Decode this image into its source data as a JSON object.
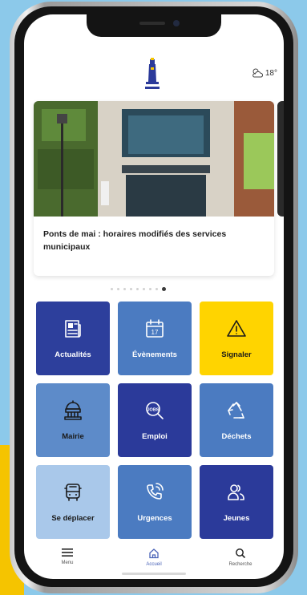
{
  "weather": {
    "temperature": "18°",
    "icon": "partly-cloudy-icon"
  },
  "logo": {
    "icon": "lighthouse-logo-icon"
  },
  "carousel": {
    "cards": [
      {
        "title": "Ponts de mai : horaires modifiés des services municipaux",
        "image": "town-hall-photo"
      }
    ],
    "dot_count": 9,
    "active_index": 8
  },
  "tiles": [
    {
      "label": "Actualités",
      "icon": "newspaper-icon",
      "bg": "#2d3f9c",
      "fg": "#ffffff"
    },
    {
      "label": "Évènements",
      "icon": "calendar-icon",
      "bg": "#4b7bc1",
      "fg": "#ffffff"
    },
    {
      "label": "Signaler",
      "icon": "warning-icon",
      "bg": "#ffd400",
      "fg": "#1a1a1a"
    },
    {
      "label": "Mairie",
      "icon": "town-hall-icon",
      "bg": "#5d8bc9",
      "fg": "#1a1a1a"
    },
    {
      "label": "Emploi",
      "icon": "job-search-icon",
      "bg": "#2b3a9a",
      "fg": "#ffffff"
    },
    {
      "label": "Déchets",
      "icon": "recycle-icon",
      "bg": "#4b7bc1",
      "fg": "#ffffff"
    },
    {
      "label": "Se déplacer",
      "icon": "bus-icon",
      "bg": "#a9c8ea",
      "fg": "#1a1a1a"
    },
    {
      "label": "Urgences",
      "icon": "phone-call-icon",
      "bg": "#4b7bc1",
      "fg": "#ffffff"
    },
    {
      "label": "Jeunes",
      "icon": "people-icon",
      "bg": "#2b3a9a",
      "fg": "#ffffff"
    }
  ],
  "nav": {
    "menu": "Menu",
    "home": "Accueil",
    "search": "Recherche"
  },
  "colors": {
    "accent": "#4a63b8",
    "device_bg": "#8cc9ea",
    "yellow": "#f5c400"
  }
}
